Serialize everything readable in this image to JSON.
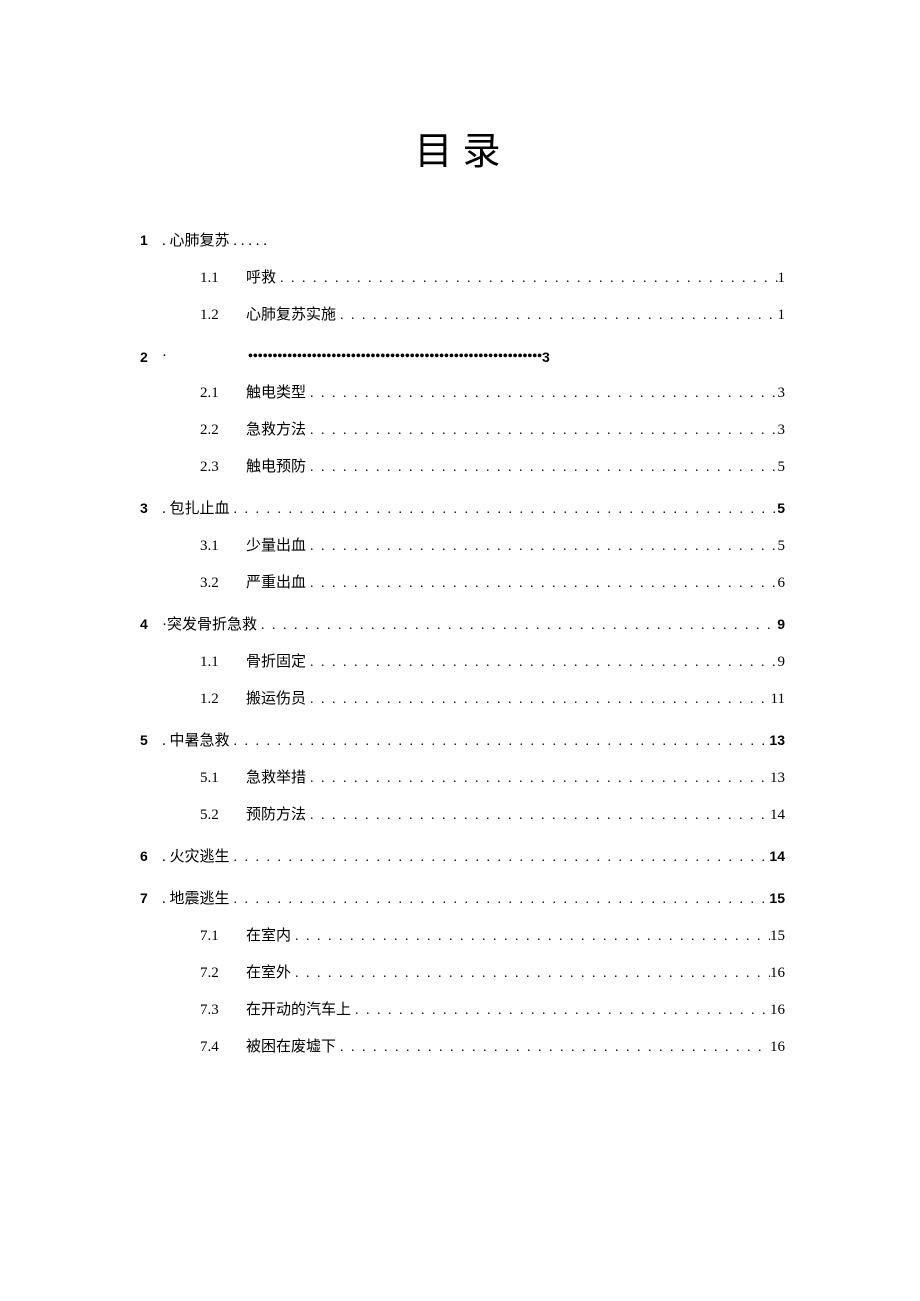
{
  "title": "目录",
  "leader_default": ". . . . . . . . . . . . . . . . . . . . . . . . . . . . . . . . . . . . . . . . . . . . . . . . . . . . . . . . . . . . . . . . . . . . . . . . . . . . . . . . . . . . . . . . . . . . . . . . . . . . . . . . . . . . . . . . . .",
  "leader_bold": "•••••••••••••••••••••••••••••••••••••••••••••••••••••••••••••••••••••••••••••••••••••••••••••••••••",
  "sections": [
    {
      "num": "1",
      "title": " . 心肺复苏 . . . . .",
      "page": "",
      "style": "no-leader no-page",
      "subs": [
        {
          "num": "1.1",
          "title": "呼救",
          "page": "1"
        },
        {
          "num": "1.2",
          "title": "心肺复苏实施",
          "page": "1"
        }
      ]
    },
    {
      "num": "2",
      "title": "  ·",
      "page": "3",
      "style": "bold-leader short-leader",
      "subs": [
        {
          "num": "2.1",
          "title": "触电类型",
          "page": "3"
        },
        {
          "num": "2.2",
          "title": "急救方法",
          "page": "3"
        },
        {
          "num": "2.3",
          "title": "触电预防",
          "page": "5"
        }
      ]
    },
    {
      "num": "3",
      "title": " . 包扎止血",
      "page": "5",
      "style": "",
      "subs": [
        {
          "num": "3.1",
          "title": "少量出血",
          "page": "5"
        },
        {
          "num": "3.2",
          "title": "严重出血",
          "page": "6"
        }
      ]
    },
    {
      "num": "4",
      "title": "·突发骨折急救 ",
      "page": "9",
      "style": "",
      "l1_sep": "",
      "subs": [
        {
          "num": "1.1",
          "title": "骨折固定",
          "page": "9"
        },
        {
          "num": "1.2",
          "title": "搬运伤员",
          "page": "11"
        }
      ]
    },
    {
      "num": "5",
      "title": " . 中暑急救 ",
      "page": "13",
      "style": "",
      "subs": [
        {
          "num": "5.1",
          "title": "急救举措",
          "page": "13"
        },
        {
          "num": "5.2",
          "title": "预防方法",
          "page": "14"
        }
      ]
    },
    {
      "num": "6",
      "title": " . 火灾逃生 ",
      "page": "14",
      "style": "",
      "subs": []
    },
    {
      "num": "7",
      "title": " . 地震逃生 ",
      "page": "15",
      "style": "",
      "subs": [
        {
          "num": "7.1",
          "title": "在室内",
          "page": "15"
        },
        {
          "num": "7.2",
          "title": "在室外",
          "page": "16"
        },
        {
          "num": "7.3",
          "title": "在开动的汽车上",
          "page": "16"
        },
        {
          "num": "7.4",
          "title": "被困在废墟下",
          "page": "16"
        }
      ]
    }
  ]
}
